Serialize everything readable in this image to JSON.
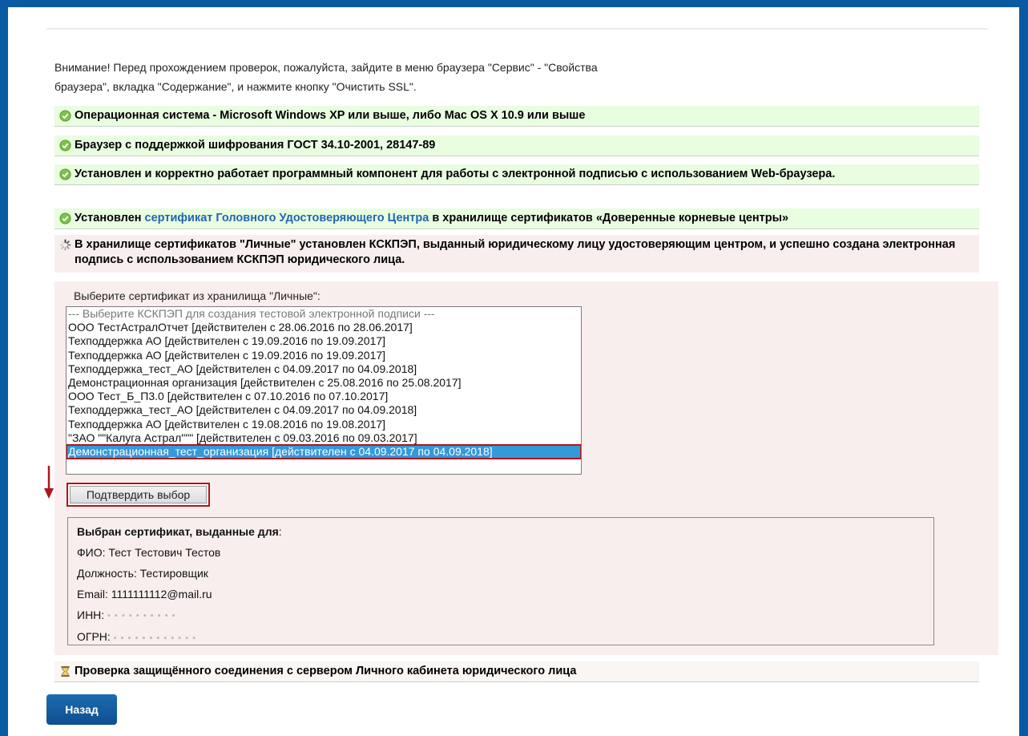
{
  "notice": {
    "line1": "Внимание! Перед прохождением проверок, пожалуйста, зайдите в меню браузера \"Сервис\" - \"Свойства",
    "line2": "браузера\", вкладка \"Содержание\", и нажмите кнопку \"Очистить SSL\"."
  },
  "checks": [
    {
      "status": "ok",
      "text": "Операционная система - Microsoft Windows XP или выше, либо Mac OS X 10.9 или выше"
    },
    {
      "status": "ok",
      "text": "Браузер с поддержкой шифрования ГОСТ 34.10-2001, 28147-89"
    },
    {
      "status": "ok",
      "text": "Установлен и корректно работает программный компонент для работы с электронной подписью с использованием Web-браузера."
    },
    {
      "status": "ok",
      "before": "Установлен ",
      "link": "сертификат Головного Удостоверяющего Центра",
      "after": " в хранилище сертификатов «Доверенные корневые центры»"
    },
    {
      "status": "pending",
      "text": "В хранилище сертификатов \"Личные\" установлен КСКПЭП, выданный юридическому лицу удостоверяющим центром, и успешно создана электронная подпись с использованием КСКПЭП юридического лица."
    }
  ],
  "cert_select": {
    "label": "Выберите сертификат из хранилища \"Личные\":",
    "options": [
      "--- Выберите КСКПЭП для создания тестовой электронной подписи ---",
      "ООО ТестАстралОтчет [действителен с 28.06.2016 по 28.06.2017]",
      "Техподдержка АО [действителен с 19.09.2016 по 19.09.2017]",
      "Техподдержка АО [действителен с 19.09.2016 по 19.09.2017]",
      "Техподдержка_тест_АО [действителен с 04.09.2017 по 04.09.2018]",
      "Демонстрационная организация [действителен с 25.08.2016 по 25.08.2017]",
      "ООО Тест_Б_П3.0 [действителен с 07.10.2016 по 07.10.2017]",
      "Техподдержка_тест_АО [действителен с 04.09.2017 по 04.09.2018]",
      "Техподдержка АО [действителен с 19.08.2016 по 19.08.2017]",
      "\"ЗАО \"\"Калуга Астрал\"\"\" [действителен с 09.03.2016 по 09.03.2017]",
      "Демонстрационная_тест_организация [действителен с 04.09.2017 по 04.09.2018]"
    ],
    "selected_index": 10,
    "confirm_label": "Подтвердить выбор"
  },
  "cert_info": {
    "title": "Выбран сертификат, выданные для",
    "title_suffix": ":",
    "fio": "ФИО: Тест Тестович Тестов",
    "position": "Должность: Тестировщик",
    "email": "Email: 1111111112@mail.ru",
    "inn_label": "ИНН: ",
    "ogrn_label": "ОГРН: "
  },
  "connection_check": {
    "status": "waiting",
    "text": "Проверка защищённого соединения с сервером Личного кабинета юридического лица"
  },
  "back_label": "Назад",
  "colors": {
    "frame": "#0a5aa3",
    "ok_bg": "#e9fde1",
    "pending_bg": "#f9eeee",
    "link": "#1e67b0",
    "selected": "#3399d9",
    "highlight": "#b0151a"
  }
}
